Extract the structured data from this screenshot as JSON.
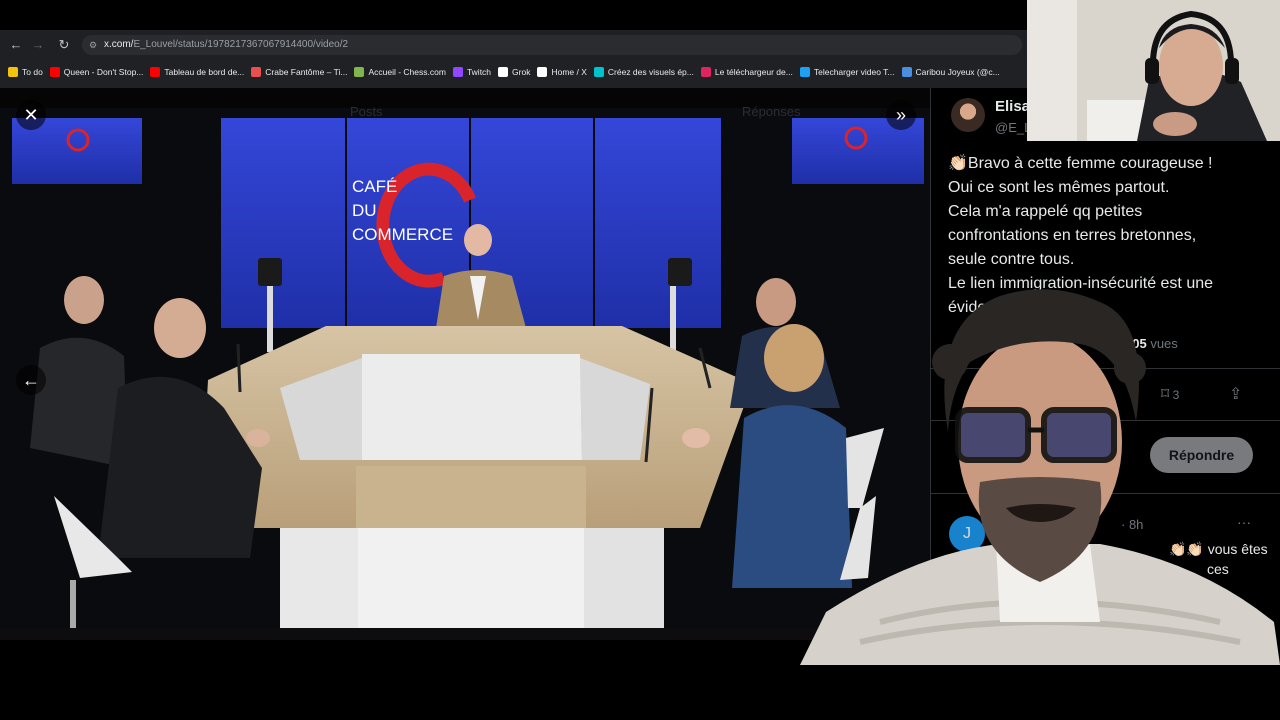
{
  "browser": {
    "url_host": "x.com/",
    "url_path": "E_Louvel/status/1978217367067914400/video/2",
    "bookmarks": [
      {
        "label": "To do",
        "color": "#f4c20d"
      },
      {
        "label": "Queen - Don't Stop...",
        "color": "#ff0000"
      },
      {
        "label": "Tableau de bord de...",
        "color": "#ff0000"
      },
      {
        "label": "Crabe Fantôme – Ti...",
        "color": "#e94f4f"
      },
      {
        "label": "Accueil - Chess.com",
        "color": "#81b64c"
      },
      {
        "label": "Twitch",
        "color": "#9146ff"
      },
      {
        "label": "Grok",
        "color": "#ffffff"
      },
      {
        "label": "Home / X",
        "color": "#ffffff"
      },
      {
        "label": "Créez des visuels ép...",
        "color": "#00c4cc"
      },
      {
        "label": "Le téléchargeur de...",
        "color": "#e0245e"
      },
      {
        "label": "Telecharger video T...",
        "color": "#1da1f2"
      },
      {
        "label": "Caribou Joyeux (@c...",
        "color": "#4a90e2"
      }
    ]
  },
  "video": {
    "logo_line1": "CAFÉ",
    "logo_line2": "DU",
    "logo_line3": "COMMERCE",
    "header_ghost_left": "Posts",
    "header_ghost_right": "Réponses",
    "close_icon": "close-icon",
    "next_icon": "double-chevron-right-icon",
    "prev_icon": "arrow-left-icon"
  },
  "post": {
    "author_name": "Elisa",
    "author_handle": "@E_L",
    "lines": [
      "👏🏻Bravo à cette femme courageuse !",
      "Oui ce sont les mêmes partout.",
      "Cela m'a rappelé qq petites",
      "confrontations en terres bretonnes,",
      "seule contre tous.",
      "Le lien immigration-insécurité est une",
      "évide"
    ],
    "views_count": "305",
    "views_label": "vues",
    "bookmark_count": "3",
    "reply_button": "Répondre"
  },
  "reply": {
    "avatar_letter": "J",
    "time": "· 8h",
    "more": "···",
    "text_line1": "👏🏻👏🏻 vous êtes",
    "text_line2": "ces"
  },
  "colors": {
    "studio_blue": "#2a3ed0",
    "logo_red": "#d8242a",
    "x_bg": "#000000",
    "x_text": "#e7e9ea",
    "x_muted": "#71767b"
  }
}
